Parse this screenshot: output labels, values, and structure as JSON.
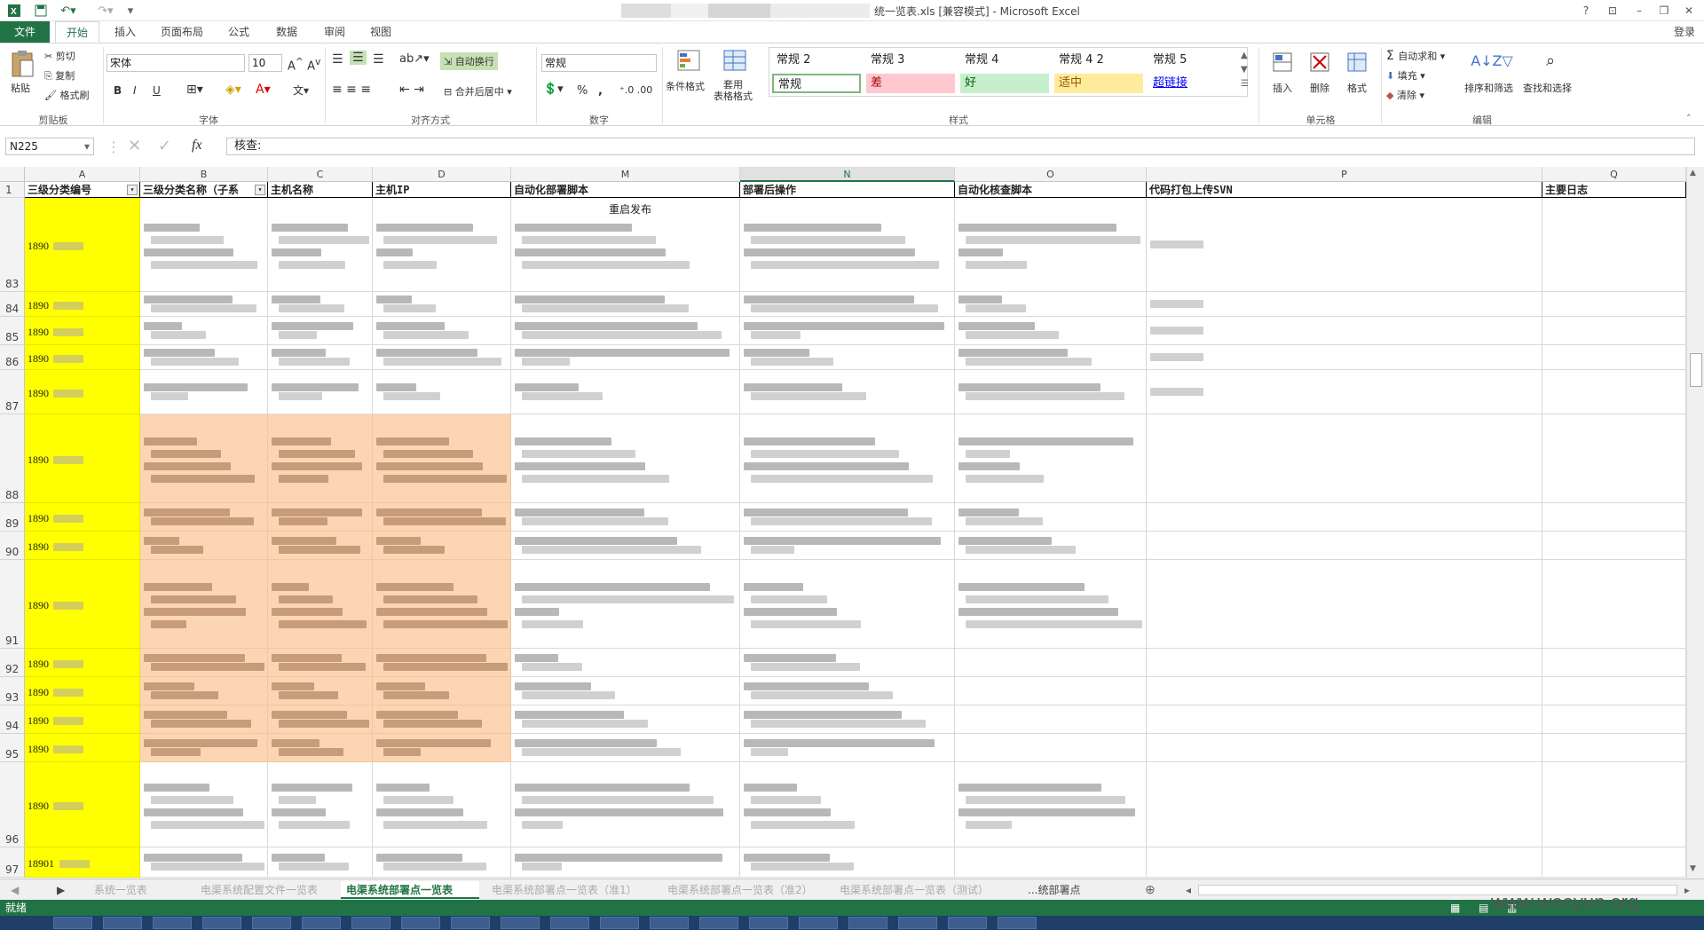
{
  "window": {
    "title": "统一览表.xls  [兼容模式] - Microsoft Excel",
    "signin": "登录"
  },
  "ribbon_tabs": [
    "文件",
    "开始",
    "插入",
    "页面布局",
    "公式",
    "数据",
    "审阅",
    "视图"
  ],
  "clipboard": {
    "paste": "粘贴",
    "cut": "剪切",
    "copy": "复制",
    "format_painter": "格式刷",
    "group": "剪贴板"
  },
  "font": {
    "name": "宋体",
    "size": "10",
    "group": "字体",
    "bold": "B",
    "italic": "I",
    "underline": "U"
  },
  "alignment": {
    "wrap": "自动换行",
    "merge": "合并后居中",
    "group": "对齐方式"
  },
  "number": {
    "format": "常规",
    "group": "数字",
    "percent": "%",
    "comma": ","
  },
  "styles": {
    "cond_format": "条件格式",
    "table_format": "套用\n表格格式",
    "group": "样式",
    "cells": [
      {
        "label": "常规 2",
        "bg": "#ffffff",
        "fg": "#222222"
      },
      {
        "label": "常规 3",
        "bg": "#ffffff",
        "fg": "#222222"
      },
      {
        "label": "常规 4",
        "bg": "#ffffff",
        "fg": "#222222"
      },
      {
        "label": "常规 4 2",
        "bg": "#ffffff",
        "fg": "#222222"
      },
      {
        "label": "常规 5",
        "bg": "#ffffff",
        "fg": "#222222"
      },
      {
        "label": "常规",
        "bg": "#ffffff",
        "fg": "#222222"
      },
      {
        "label": "差",
        "bg": "#ffc7ce",
        "fg": "#9c0006"
      },
      {
        "label": "好",
        "bg": "#c6efce",
        "fg": "#006100"
      },
      {
        "label": "适中",
        "bg": "#ffeb9c",
        "fg": "#9c5700"
      },
      {
        "label": "超链接",
        "bg": "#ffffff",
        "fg": "#0000ff"
      }
    ]
  },
  "cells_group": {
    "insert": "插入",
    "delete": "删除",
    "format": "格式",
    "group": "单元格"
  },
  "editing": {
    "autosum": "自动求和",
    "fill": "填充",
    "clear": "清除",
    "sort": "排序和筛选",
    "find": "查找和选择",
    "group": "编辑"
  },
  "formula_bar": {
    "name_box": "N225",
    "fx": "fx",
    "content": "核查:"
  },
  "columns": {
    "letters": [
      "A",
      "B",
      "C",
      "D",
      "M",
      "N",
      "O",
      "P",
      "Q"
    ],
    "headers": [
      "三级分类编号",
      "三级分类名称（子系",
      "主机名称",
      "主机IP",
      "自动化部署脚本",
      "部署后操作",
      "自动化核查脚本",
      "代码打包上传SVN",
      "主要日志"
    ],
    "row1": "1"
  },
  "rows": [
    {
      "num": "83",
      "id": "1890",
      "note": "重启发布"
    },
    {
      "num": "84",
      "id": "1890"
    },
    {
      "num": "85",
      "id": "1890"
    },
    {
      "num": "86",
      "id": "1890"
    },
    {
      "num": "87",
      "id": "1890"
    },
    {
      "num": "88",
      "id": "1890"
    },
    {
      "num": "89",
      "id": "1890"
    },
    {
      "num": "90",
      "id": "1890"
    },
    {
      "num": "91",
      "id": "1890"
    },
    {
      "num": "92",
      "id": "1890"
    },
    {
      "num": "93",
      "id": "1890"
    },
    {
      "num": "94",
      "id": "1890"
    },
    {
      "num": "95",
      "id": "1890"
    },
    {
      "num": "96",
      "id": "1890"
    },
    {
      "num": "97",
      "id": "18901"
    }
  ],
  "sheet_tabs": [
    "系统一览表",
    "电渠系统配置文件一览表",
    "电渠系统部署点一览表",
    "电渠系统部署点一览表（准1）",
    "电渠系统部署点一览表（准2）",
    "电渠系统部署点一览表（测试）",
    "...统部署点"
  ],
  "active_sheet_index": 2,
  "status": {
    "ready": "就绪"
  },
  "watermark": "www.wooyun.org",
  "colors": {
    "excel_green": "#217346",
    "highlight_yellow": "#ffff00",
    "highlight_orange": "#fcd5b4"
  }
}
